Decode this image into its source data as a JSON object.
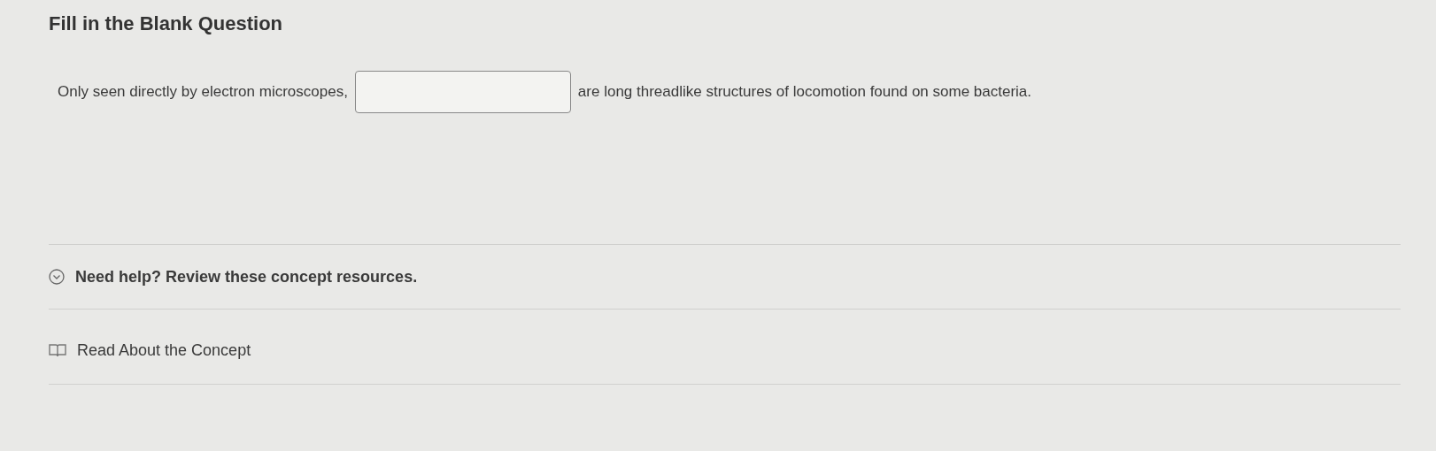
{
  "title": "Fill in the Blank Question",
  "question": {
    "before": "Only seen directly by electron microscopes,",
    "after": "are long threadlike structures of locomotion found on some bacteria."
  },
  "help": {
    "label": "Need help? Review these concept resources.",
    "expanded": true
  },
  "resources": [
    {
      "label": "Read About the Concept"
    }
  ]
}
